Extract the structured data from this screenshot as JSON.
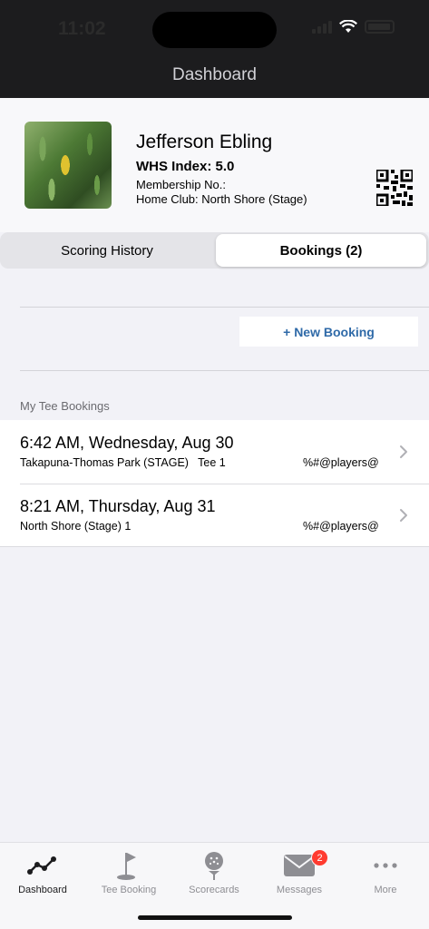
{
  "status_bar": {
    "time": "11:02"
  },
  "nav": {
    "title": "Dashboard"
  },
  "profile": {
    "name": "Jefferson Ebling",
    "whs_index": "WHS Index: 5.0",
    "membership": "Membership No.:",
    "home_club": "Home Club: North Shore (Stage)"
  },
  "segments": {
    "left": "Scoring History",
    "right": "Bookings (2)",
    "selected": "right"
  },
  "actions": {
    "new_booking": "+ New Booking"
  },
  "section": {
    "title": "My Tee Bookings"
  },
  "bookings": [
    {
      "time": "6:42 AM, Wednesday, Aug 30",
      "course": "Takapuna-Thomas Park (STAGE)   Tee 1",
      "players": "%#@players@"
    },
    {
      "time": "8:21 AM, Thursday, Aug 31",
      "course": "North Shore (Stage) 1",
      "players": "%#@players@"
    }
  ],
  "tab_bar": {
    "selected": "Dashboard",
    "items": [
      {
        "label": "Dashboard",
        "icon": "dashboard-graph-icon"
      },
      {
        "label": "Tee Booking",
        "icon": "golf-flag-icon"
      },
      {
        "label": "Scorecards",
        "icon": "golf-ball-tee-icon"
      },
      {
        "label": "Messages",
        "icon": "envelope-icon",
        "badge": "2"
      },
      {
        "label": "More",
        "icon": "more-dots-icon"
      }
    ]
  },
  "colors": {
    "accent": "#2f6aa8",
    "badge": "#ff3b30",
    "header": "#1c1c1e"
  }
}
